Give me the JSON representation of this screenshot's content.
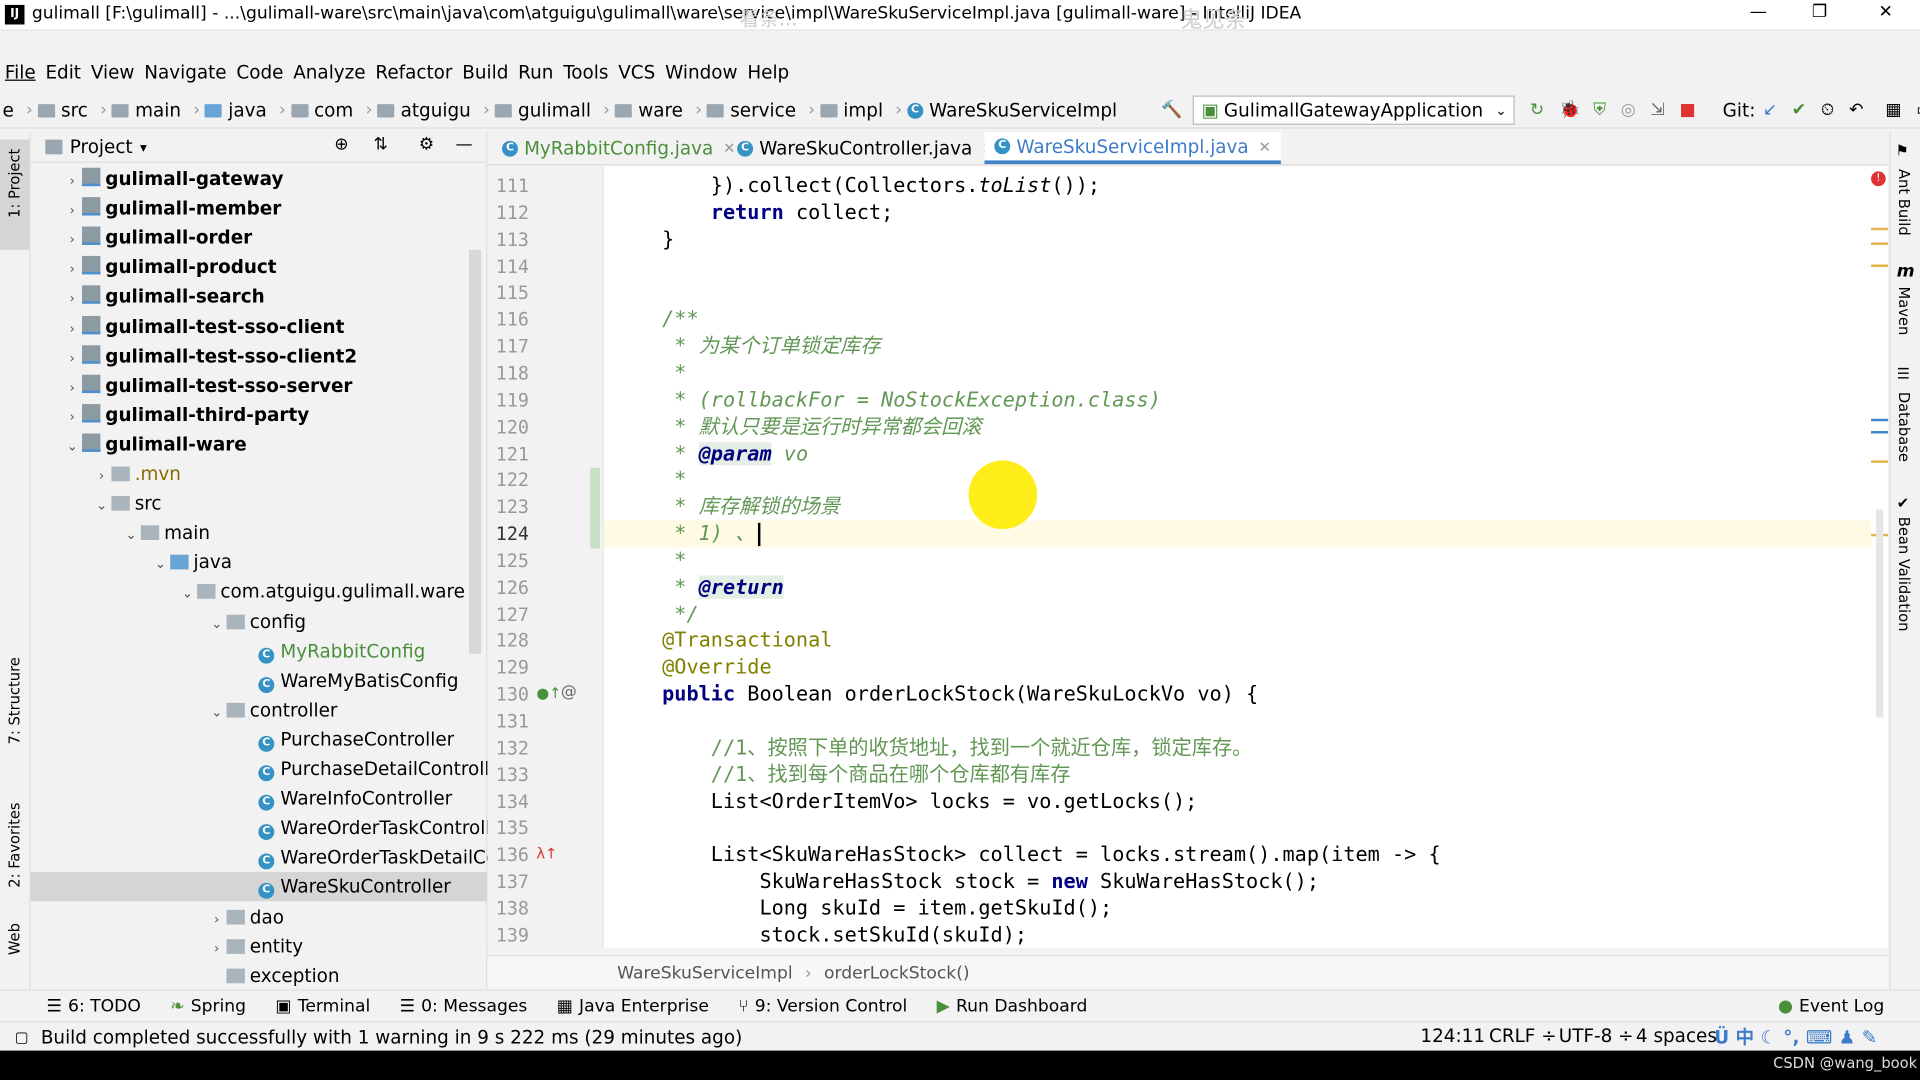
{
  "window": {
    "title": "gulimall [F:\\gulimall] - ...\\gulimall-ware\\src\\main\\java\\com\\atguigu\\gulimall\\ware\\service\\impl\\WareSkuServiceImpl.java [gulimall-ware] - IntelliJ IDEA",
    "app_icon": "IJ",
    "watermark_left": "看条...",
    "watermark_right": "鬼见条"
  },
  "menu": [
    "File",
    "Edit",
    "View",
    "Navigate",
    "Code",
    "Analyze",
    "Refactor",
    "Build",
    "Run",
    "Tools",
    "VCS",
    "Window",
    "Help"
  ],
  "nav": {
    "lead": "e",
    "crumbs": [
      "src",
      "main",
      "java",
      "com",
      "atguigu",
      "gulimall",
      "ware",
      "service",
      "impl"
    ],
    "file": "WareSkuServiceImpl",
    "run_config": "GulimallGatewayApplication",
    "git_label": "Git:"
  },
  "left_stripe": [
    "1: Project",
    "7: Structure",
    "2: Favorites",
    "Web"
  ],
  "project": {
    "header": "Project",
    "tree": [
      {
        "label": "gulimall-gateway",
        "arrow": "›",
        "kind": "module"
      },
      {
        "label": "gulimall-member",
        "arrow": "›",
        "kind": "module"
      },
      {
        "label": "gulimall-order",
        "arrow": "›",
        "kind": "module"
      },
      {
        "label": "gulimall-product",
        "arrow": "›",
        "kind": "module"
      },
      {
        "label": "gulimall-search",
        "arrow": "›",
        "kind": "module"
      },
      {
        "label": "gulimall-test-sso-client",
        "arrow": "›",
        "kind": "module"
      },
      {
        "label": "gulimall-test-sso-client2",
        "arrow": "›",
        "kind": "module"
      },
      {
        "label": "gulimall-test-sso-server",
        "arrow": "›",
        "kind": "module"
      },
      {
        "label": "gulimall-third-party",
        "arrow": "›",
        "kind": "module"
      },
      {
        "label": "gulimall-ware",
        "arrow": "⌄",
        "kind": "module"
      },
      {
        "label": ".mvn",
        "arrow": "›",
        "kind": "folder"
      },
      {
        "label": "src",
        "arrow": "⌄",
        "kind": "folder"
      },
      {
        "label": "main",
        "arrow": "⌄",
        "kind": "folder"
      },
      {
        "label": "java",
        "arrow": "⌄",
        "kind": "source"
      },
      {
        "label": "com.atguigu.gulimall.ware",
        "arrow": "⌄",
        "kind": "package"
      },
      {
        "label": "config",
        "arrow": "⌄",
        "kind": "package"
      },
      {
        "label": "MyRabbitConfig",
        "arrow": "",
        "kind": "class-green"
      },
      {
        "label": "WareMyBatisConfig",
        "arrow": "",
        "kind": "class"
      },
      {
        "label": "controller",
        "arrow": "⌄",
        "kind": "package"
      },
      {
        "label": "PurchaseController",
        "arrow": "",
        "kind": "class"
      },
      {
        "label": "PurchaseDetailController",
        "arrow": "",
        "kind": "class"
      },
      {
        "label": "WareInfoController",
        "arrow": "",
        "kind": "class"
      },
      {
        "label": "WareOrderTaskControlle",
        "arrow": "",
        "kind": "class"
      },
      {
        "label": "WareOrderTaskDetailCo",
        "arrow": "",
        "kind": "class"
      },
      {
        "label": "WareSkuController",
        "arrow": "",
        "kind": "class",
        "selected": true
      },
      {
        "label": "dao",
        "arrow": "›",
        "kind": "package"
      },
      {
        "label": "entity",
        "arrow": "›",
        "kind": "package"
      },
      {
        "label": "exception",
        "arrow": "",
        "kind": "package"
      }
    ]
  },
  "tabs": [
    {
      "label": "MyRabbitConfig.java",
      "active": false
    },
    {
      "label": "WareSkuController.java",
      "active": false
    },
    {
      "label": "WareSkuServiceImpl.java",
      "active": true
    }
  ],
  "code": {
    "line_numbers": [
      "111",
      "112",
      "113",
      "114",
      "115",
      "116",
      "117",
      "118",
      "119",
      "120",
      "121",
      "122",
      "123",
      "124",
      "125",
      "126",
      "127",
      "128",
      "129",
      "130",
      "131",
      "132",
      "133",
      "134",
      "135",
      "136",
      "137",
      "138",
      "139"
    ],
    "lines": [
      "        }).collect(Collectors.toList());",
      "        return collect;",
      "    }",
      "",
      "",
      "    /**",
      "     * 为某个订单锁定库存",
      "     *",
      "     * (rollbackFor = NoStockException.class)",
      "     * 默认只要是运行时异常都会回滚",
      "     * @param vo",
      "     *",
      "     * 库存解锁的场景",
      "     * 1) 、",
      "     *",
      "     * @return",
      "     */",
      "    @Transactional",
      "    @Override",
      "    public Boolean orderLockStock(WareSkuLockVo vo) {",
      "",
      "        //1、按照下单的收货地址，找到一个就近仓库，锁定库存。",
      "        //1、找到每个商品在哪个仓库都有库存",
      "        List<OrderItemVo> locks = vo.getLocks();",
      "",
      "        List<SkuWareHasStock> collect = locks.stream().map(item -> {",
      "            SkuWareHasStock stock = new SkuWareHasStock();",
      "            Long skuId = item.getSkuId();",
      "            stock.setSkuId(skuId);"
    ]
  },
  "editor_breadcrumb": [
    "WareSkuServiceImpl",
    "orderLockStock()"
  ],
  "right_stripe": [
    "Ant Build",
    "Maven",
    "Database",
    "Bean Validation"
  ],
  "bottom_tools": [
    "6: TODO",
    "Spring",
    "Terminal",
    "0: Messages",
    "Java Enterprise",
    "9: Version Control",
    "Run Dashboard"
  ],
  "event_log": "Event Log",
  "status": {
    "message": "Build completed successfully with 1 warning in 9 s 222 ms (29 minutes ago)",
    "position": "124:11",
    "line_sep": "CRLF",
    "encoding": "UTF-8",
    "indent": "4 spaces",
    "ime": "中"
  },
  "credit": "CSDN @wang_book",
  "colors": {
    "accent": "#4083c9",
    "comment": "#629755",
    "keyword": "#000080",
    "annotation": "#808000"
  }
}
